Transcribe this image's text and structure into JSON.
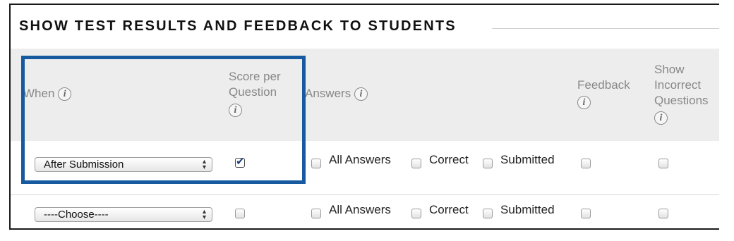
{
  "section": {
    "title": "SHOW TEST RESULTS AND FEEDBACK TO STUDENTS"
  },
  "headers": {
    "when": "When",
    "score_per_question": [
      "Score per",
      "Question"
    ],
    "answers": "Answers",
    "feedback": "Feedback",
    "show_incorrect": [
      "Show",
      "Incorrect",
      "Questions"
    ]
  },
  "info_icon_glyph": "i",
  "options": {
    "all_answers": "All Answers",
    "correct": "Correct",
    "submitted": "Submitted"
  },
  "rows": [
    {
      "when_value": "After Submission",
      "score_per_question_checked": true,
      "all_answers_checked": false,
      "correct_checked": false,
      "submitted_checked": false,
      "feedback_checked": false,
      "show_incorrect_checked": false
    },
    {
      "when_value": "----Choose----",
      "score_per_question_checked": false,
      "all_answers_checked": false,
      "correct_checked": false,
      "submitted_checked": false,
      "feedback_checked": false,
      "show_incorrect_checked": false
    }
  ],
  "colors": {
    "highlight_border": "#175aa0",
    "header_background": "#ededed",
    "checkmark": "#1d3f7a"
  }
}
